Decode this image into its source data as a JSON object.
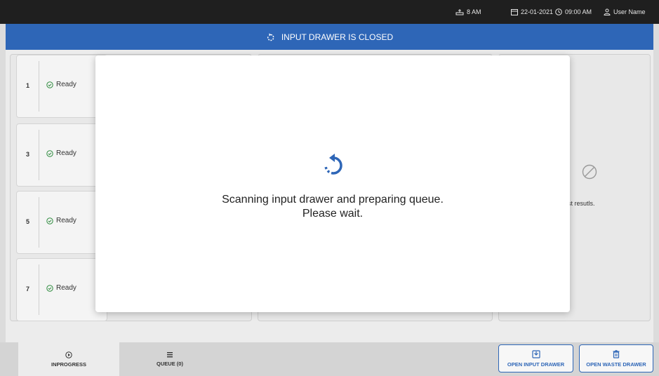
{
  "topbar": {
    "temperature": "8 AM",
    "date": "22-01-2021",
    "time": "09:00 AM",
    "user": "User Name"
  },
  "banner": {
    "text": "INPUT DRAWER IS CLOSED"
  },
  "slots": [
    {
      "number": "1",
      "status": "Ready"
    },
    {
      "number": "3",
      "status": "Ready"
    },
    {
      "number": "5",
      "status": "Ready"
    },
    {
      "number": "7",
      "status": "Ready"
    }
  ],
  "results_panel": {
    "partial_text": "st resutls."
  },
  "modal": {
    "line1": "Scanning input drawer and preparing queue.",
    "line2": "Please wait."
  },
  "tabs": {
    "inprogress": "INPROGRESS",
    "queue": "QUEUE (0)"
  },
  "buttons": {
    "open_input": "OPEN INPUT DRAWER",
    "open_waste": "OPEN WASTE DRAWER"
  },
  "colors": {
    "accent": "#2e66b7",
    "ready_green": "#2e8b3e",
    "topbar": "#1f1f1f"
  }
}
